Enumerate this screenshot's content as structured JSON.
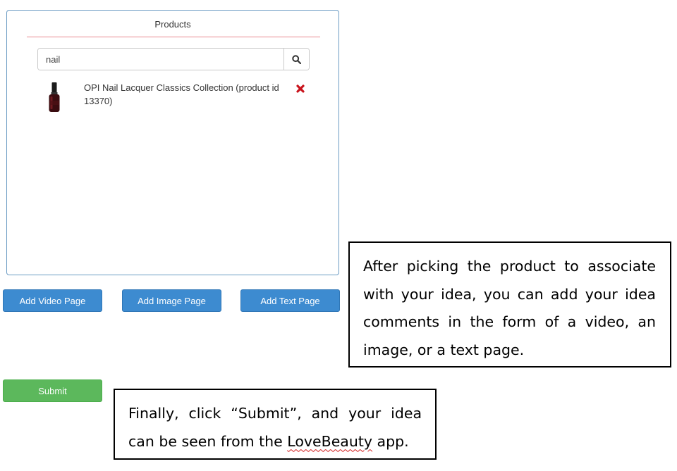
{
  "products_panel": {
    "title": "Products",
    "search": {
      "value": "nail",
      "button_icon": "search-icon"
    },
    "results": [
      {
        "name": "OPI Nail Lacquer Classics Collection (product id 13370)",
        "thumbnail": "nail-polish-bottle-icon",
        "remove_icon": "remove-x-icon"
      }
    ]
  },
  "page_buttons": {
    "add_video": "Add Video Page",
    "add_image": "Add Image Page",
    "add_text": "Add Text Page"
  },
  "submit_label": "Submit",
  "callouts": {
    "add_pages": "After picking the product to associate with your idea, you can add your idea comments in the form of a video, an image, or a text page.",
    "submit": {
      "before": "Finally, click “Submit”, and your idea can be seen from the ",
      "app_name": "LoveBeauty",
      "after": " app."
    }
  },
  "colors": {
    "primary_button": "#3d8bd0",
    "success_button": "#5cb85c",
    "panel_border": "#6a9bc3",
    "title_rule": "#e8898f",
    "remove_icon": "#c9141d"
  }
}
